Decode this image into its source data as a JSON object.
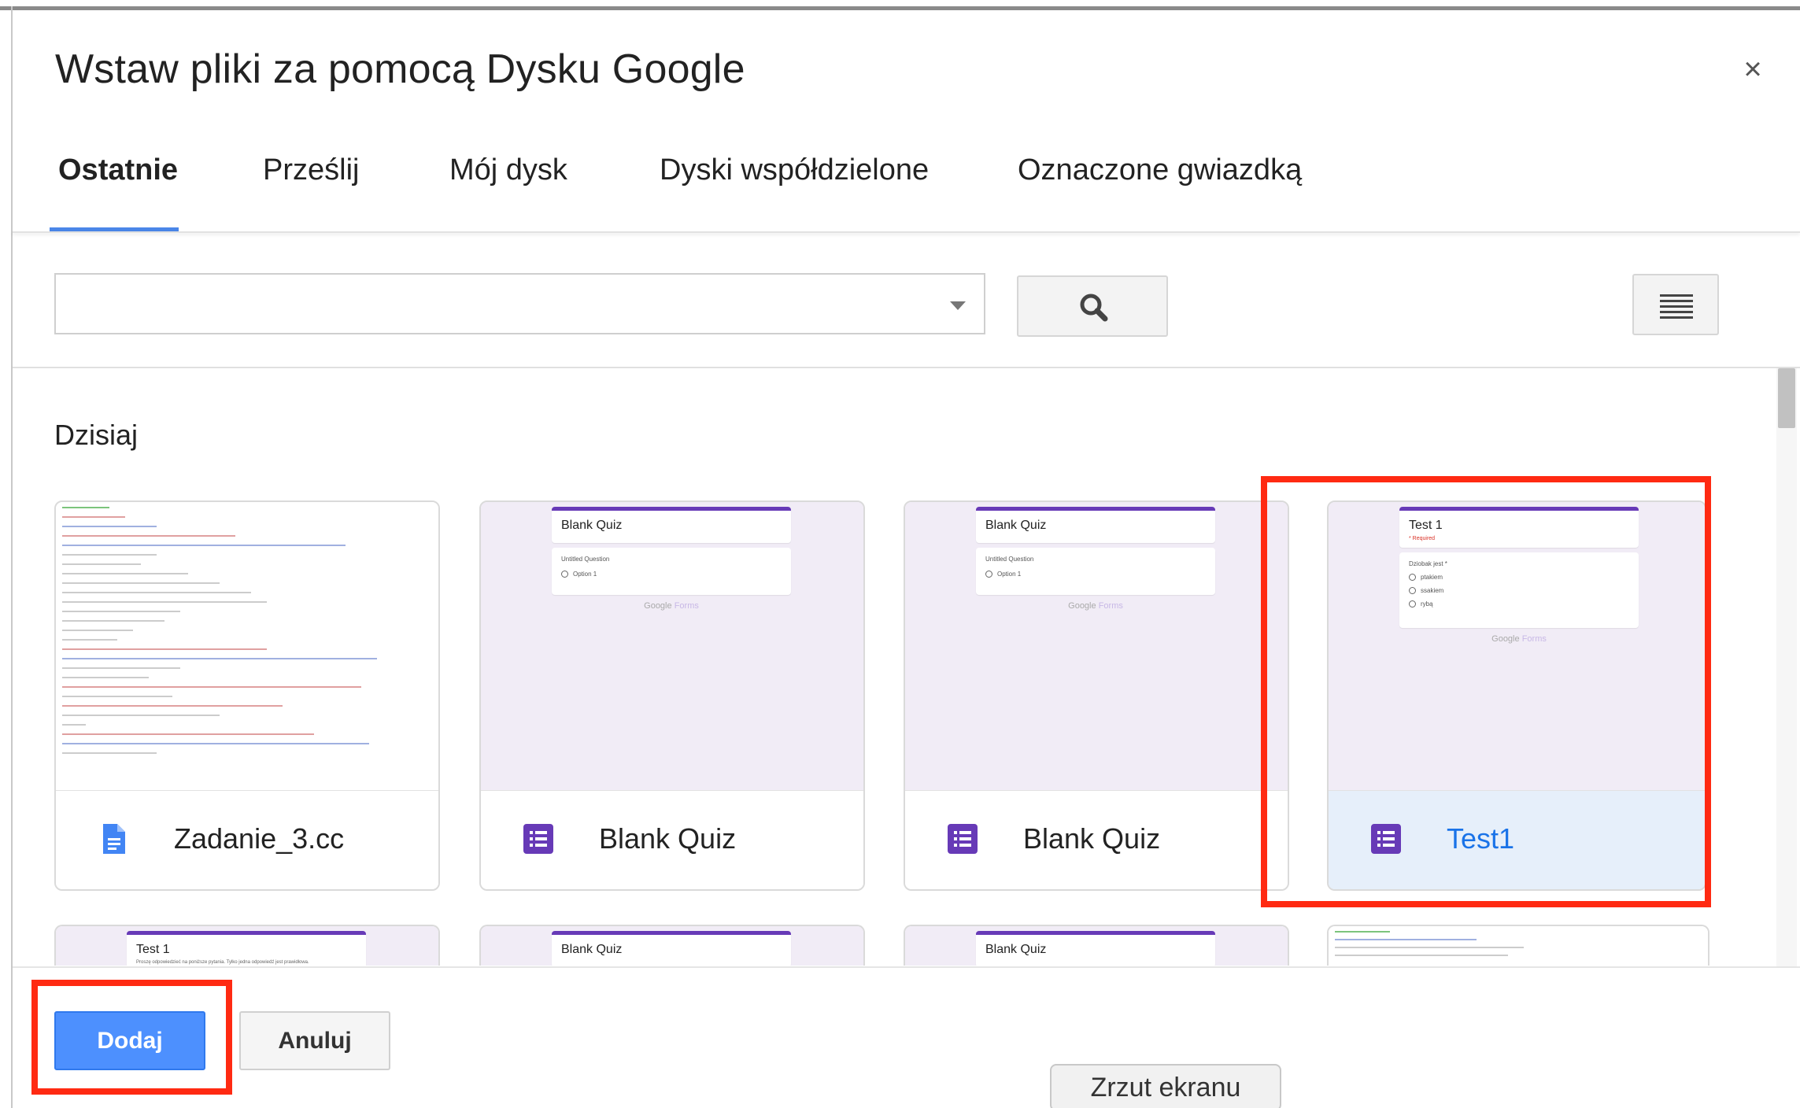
{
  "dialog": {
    "title": "Wstaw pliki za pomocą Dysku Google",
    "close_label": "×"
  },
  "tabs": [
    {
      "label": "Ostatnie",
      "active": true
    },
    {
      "label": "Prześlij",
      "active": false
    },
    {
      "label": "Mój dysk",
      "active": false
    },
    {
      "label": "Dyski współdzielone",
      "active": false
    },
    {
      "label": "Oznaczone gwiazdką",
      "active": false
    }
  ],
  "search": {
    "value": "",
    "placeholder": ""
  },
  "section": {
    "heading": "Dzisiaj"
  },
  "files": [
    {
      "name": "Zadanie_3.cc",
      "type": "document",
      "icon": "google-docs-icon",
      "selected": false
    },
    {
      "name": "Blank Quiz",
      "type": "form",
      "icon": "google-forms-icon",
      "selected": false,
      "preview": {
        "title": "Blank Quiz",
        "question": "Untitled Question",
        "option": "Option 1"
      }
    },
    {
      "name": "Blank Quiz",
      "type": "form",
      "icon": "google-forms-icon",
      "selected": false,
      "preview": {
        "title": "Blank Quiz",
        "question": "Untitled Question",
        "option": "Option 1"
      }
    },
    {
      "name": "Test1",
      "type": "form",
      "icon": "google-forms-icon",
      "selected": true,
      "preview": {
        "title": "Test 1",
        "required": "* Required",
        "question": "Dziobak jest *",
        "options": [
          "ptakiem",
          "ssakiem",
          "rybą"
        ]
      }
    }
  ],
  "files_row2": [
    {
      "preview_title": "Test 1",
      "preview_text": "Proszę odpowiedzieć na poniższe pytania. Tylko jedna odpowiedź jest prawidłowa."
    },
    {
      "preview_title": "Blank Quiz"
    },
    {
      "preview_title": "Blank Quiz"
    },
    {
      "preview_title": ""
    }
  ],
  "preview_common": {
    "brand_google": "Google",
    "brand_forms": "Forms"
  },
  "buttons": {
    "add": "Dodaj",
    "cancel": "Anuluj"
  },
  "tooltip": {
    "text": "Zrzut ekranu"
  },
  "colors": {
    "accent": "#4a86e8",
    "primary_button": "#4d90fe",
    "forms_purple": "#673ab7",
    "highlight": "#ff2a12",
    "selected_bg": "#e6effa"
  }
}
